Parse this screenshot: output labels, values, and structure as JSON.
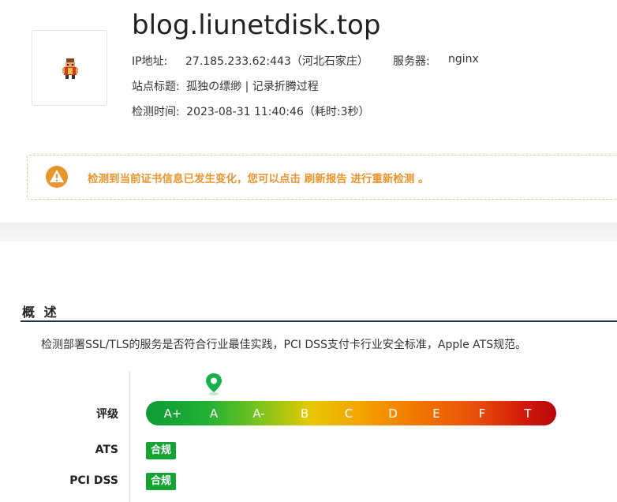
{
  "site": {
    "domain": "blog.liunetdisk.top",
    "ip_label": "IP地址:",
    "ip_value": "27.185.233.62:443（河北石家庄）",
    "server_label": "服务器:",
    "server_value": "nginx",
    "title_label": "站点标题:",
    "title_value": "孤独の缥缈 | 记录折腾过程",
    "time_label": "检测时间:",
    "time_value": "2023-08-31 11:40:46（耗时:3秒）"
  },
  "warning": {
    "icon": "warning-icon",
    "text": "检测到当前证书信息已发生变化，您可以点击 刷新报告 进行重新检测 。"
  },
  "overview": {
    "title": "概 述",
    "description": "检测部署SSL/TLS的服务是否符合行业最佳实践，PCI DSS支付卡行业安全标准，Apple ATS规范。",
    "rating_label": "评级",
    "grades": [
      "A+",
      "A",
      "A-",
      "B",
      "C",
      "D",
      "E",
      "F",
      "T"
    ],
    "current_grade": "A",
    "ats_label": "ATS",
    "ats_status": "合规",
    "pci_label": "PCI DSS",
    "pci_status": "合规"
  },
  "colors": {
    "warning": "#e8952e",
    "compliant": "#15a334",
    "section_line": "#1f2f56"
  }
}
